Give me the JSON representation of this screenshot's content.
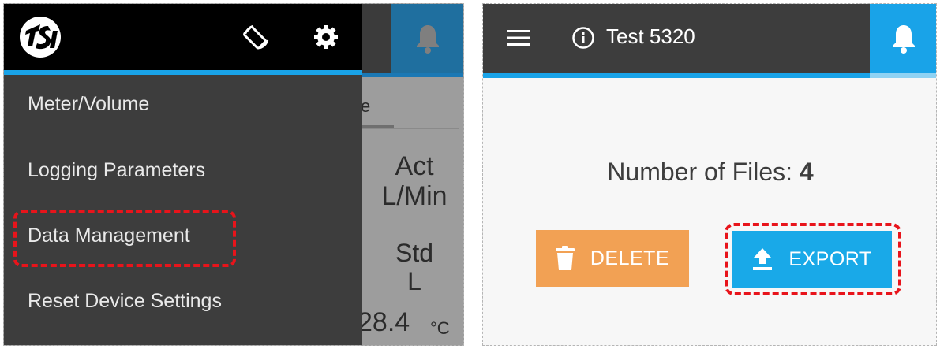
{
  "left_screen": {
    "background": {
      "tab_fragment": "e",
      "act_label": "Act",
      "act_unit": "L/Min",
      "std_label": "Std",
      "std_unit": "L",
      "temperature_value": "28.4",
      "temperature_unit": "°C"
    },
    "drawer": {
      "logo_icon": "tsi-logo",
      "header_icons": [
        "screen-rotation-icon",
        "gear-icon"
      ],
      "menu_items": [
        {
          "label": "Meter/Volume"
        },
        {
          "label": "Logging Parameters"
        },
        {
          "label": "Data Management",
          "highlighted": true
        },
        {
          "label": "Reset Device Settings"
        }
      ]
    },
    "bell_icon": "bell-icon"
  },
  "right_screen": {
    "header": {
      "menu_icon": "hamburger-menu-icon",
      "info_icon": "info-icon",
      "title": "Test 5320",
      "bell_icon": "bell-icon"
    },
    "files_label": "Number of Files:",
    "files_count": "4",
    "buttons": {
      "delete_label": "DELETE",
      "export_label": "EXPORT"
    }
  },
  "colors": {
    "accent_blue": "#19a3e8",
    "delete_orange": "#f2a154",
    "highlight_red": "#e8141b",
    "drawer_dark": "#3d3d3d"
  }
}
